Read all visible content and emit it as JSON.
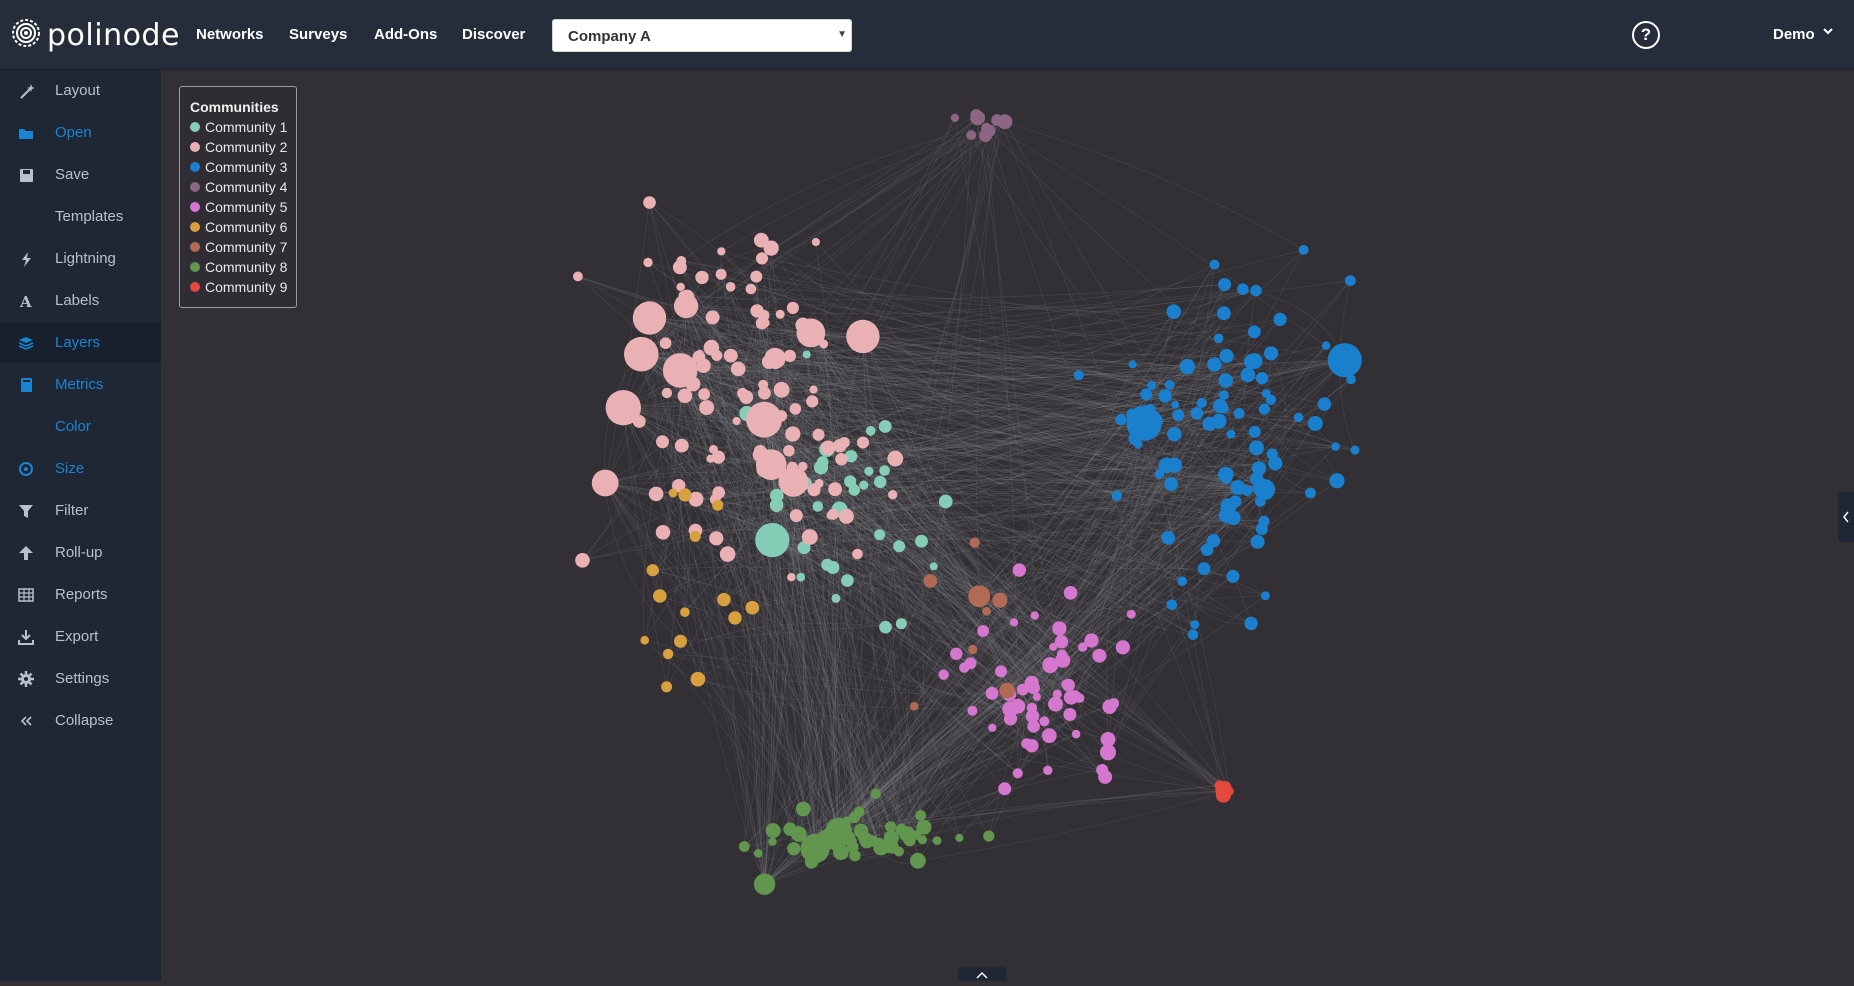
{
  "app": {
    "logo_text": "polinode"
  },
  "nav": [
    {
      "label": "Networks"
    },
    {
      "label": "Surveys"
    },
    {
      "label": "Add-Ons"
    },
    {
      "label": "Discover"
    }
  ],
  "selector": {
    "value": "Company A"
  },
  "user": {
    "name": "Demo",
    "help_label": "?"
  },
  "sidebar": {
    "items": [
      {
        "label": "Layout",
        "icon": "magic-wand-icon",
        "color": "#b9c0cc"
      },
      {
        "label": "Open",
        "icon": "folder-open-icon",
        "color": "#1a84d2"
      },
      {
        "label": "Save",
        "icon": "save-icon",
        "color": "#b9c0cc"
      },
      {
        "label": "Templates",
        "icon": "palette-icon",
        "color": "#b9c0cc"
      },
      {
        "label": "Lightning",
        "icon": "lightning-icon",
        "color": "#b9c0cc"
      },
      {
        "label": "Labels",
        "icon": "font-icon",
        "color": "#b9c0cc"
      },
      {
        "label": "Layers",
        "icon": "layers-icon",
        "color": "#1a84d2"
      },
      {
        "label": "Metrics",
        "icon": "metrics-icon",
        "color": "#1a84d2"
      },
      {
        "label": "Color",
        "icon": "droplet-icon",
        "color": "#1a84d2"
      },
      {
        "label": "Size",
        "icon": "target-icon",
        "color": "#1a84d2"
      },
      {
        "label": "Filter",
        "icon": "filter-icon",
        "color": "#b9c0cc"
      },
      {
        "label": "Roll-up",
        "icon": "arrow-up-icon",
        "color": "#b9c0cc"
      },
      {
        "label": "Reports",
        "icon": "table-icon",
        "color": "#b9c0cc"
      },
      {
        "label": "Export",
        "icon": "download-icon",
        "color": "#b9c0cc"
      },
      {
        "label": "Settings",
        "icon": "gear-icon",
        "color": "#b9c0cc"
      },
      {
        "label": "Collapse",
        "icon": "double-chevron-left-icon",
        "color": "#b9c0cc"
      }
    ],
    "active_item": "Layers"
  },
  "legend": {
    "title": "Communities",
    "items": [
      {
        "label": "Community 1",
        "color": "#85cdb6"
      },
      {
        "label": "Community 2",
        "color": "#e9b1b4"
      },
      {
        "label": "Community 3",
        "color": "#1a7fcc"
      },
      {
        "label": "Community 4",
        "color": "#8c6682"
      },
      {
        "label": "Community 5",
        "color": "#d577cf"
      },
      {
        "label": "Community 6",
        "color": "#d9a040"
      },
      {
        "label": "Community 7",
        "color": "#b06a55"
      },
      {
        "label": "Community 8",
        "color": "#62964f"
      },
      {
        "label": "Community 9",
        "color": "#e5493d"
      }
    ]
  },
  "colors": {
    "topbar": "#252d3b",
    "sidebar": "#1f2634",
    "canvas": "#323034",
    "accent": "#1a84d2",
    "edge": "#8a8a8e"
  }
}
